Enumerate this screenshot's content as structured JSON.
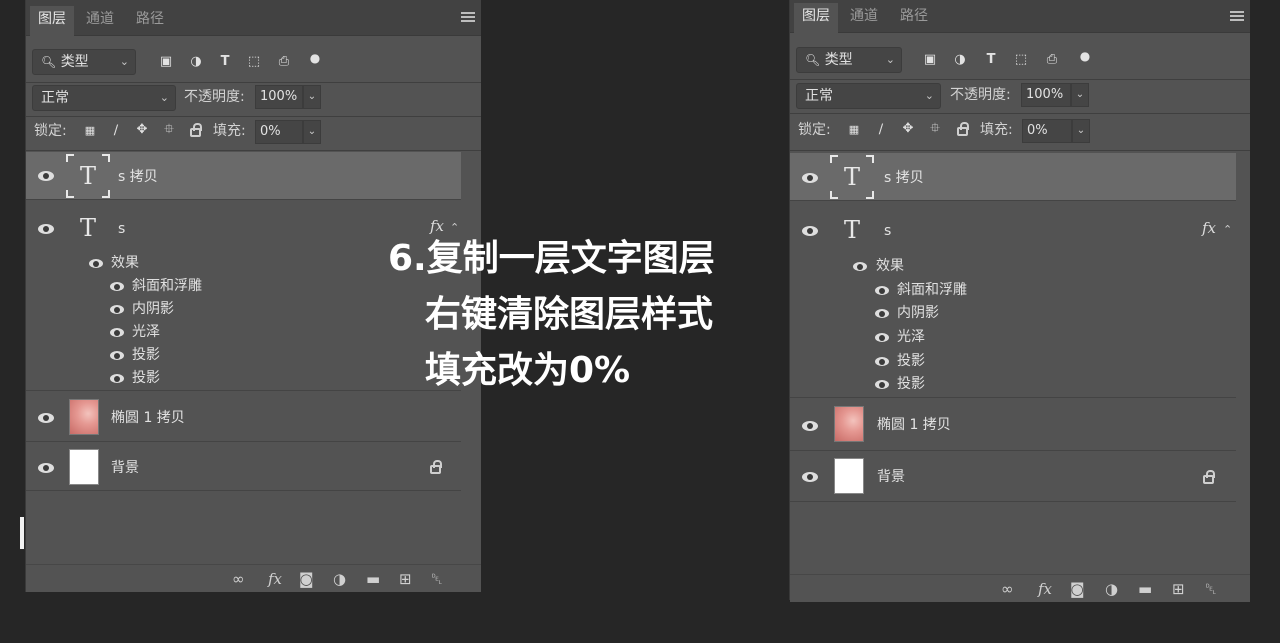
{
  "tabs": [
    "图层",
    "通道",
    "路径"
  ],
  "filter": {
    "label": "类型"
  },
  "blend": {
    "mode": "正常",
    "opacity_label": "不透明度:",
    "opacity_value": "100%"
  },
  "lock": {
    "label": "锁定:",
    "fill_label": "填充:",
    "fill_value": "0%"
  },
  "layers": {
    "copy_text": "s 拷贝",
    "text": "s",
    "effects_label": "效果",
    "effects": [
      "斜面和浮雕",
      "内阴影",
      "光泽",
      "投影",
      "投影"
    ],
    "ellipse": "椭圆 1 拷贝",
    "background": "背景"
  },
  "caption": {
    "line1": "6.复制一层文字图层",
    "line2": "右键清除图层样式",
    "line3": "填充改为0%"
  },
  "colors": {
    "panel": "#535353",
    "background": "#262626",
    "selected_row": "#6a6a6a"
  }
}
